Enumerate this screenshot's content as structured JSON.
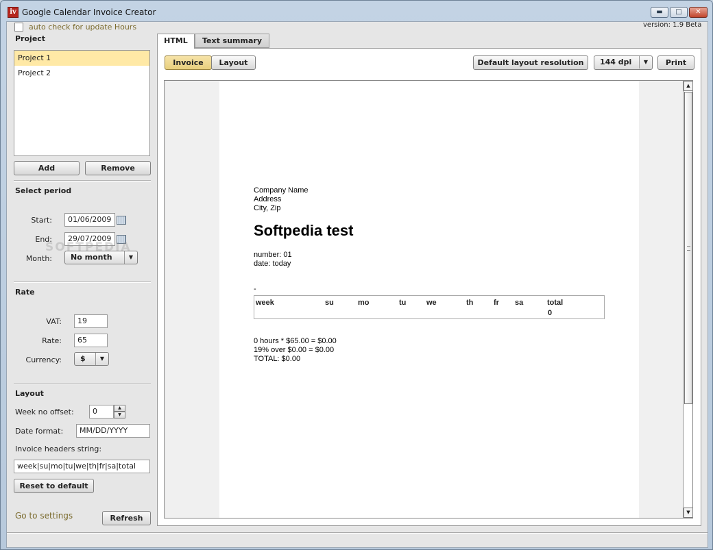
{
  "window": {
    "title": "Google Calendar Invoice Creator",
    "version": "version: 1.9 Beta"
  },
  "update": {
    "label": "auto check for update Hours"
  },
  "project": {
    "title": "Project",
    "items": [
      "Project 1",
      "Project 2"
    ],
    "add_label": "Add",
    "remove_label": "Remove"
  },
  "period": {
    "title": "Select period",
    "start_label": "Start:",
    "start_value": "01/06/2009",
    "end_label": "End:",
    "end_value": "29/07/2009",
    "month_label": "Month:",
    "month_value": "No month"
  },
  "watermark": "SOFTPEDIA",
  "rate": {
    "title": "Rate",
    "vat_label": "VAT:",
    "vat_value": "19",
    "rate_label": "Rate:",
    "rate_value": "65",
    "currency_label": "Currency:",
    "currency_value": "$"
  },
  "layout": {
    "title": "Layout",
    "week_offset_label": "Week no offset:",
    "week_offset_value": "0",
    "date_format_label": "Date format:",
    "date_format_value": "MM/DD/YYYY",
    "headers_label": "Invoice headers string:",
    "headers_value": "week|su|mo|tu|we|th|fr|sa|total",
    "reset_label": "Reset to default"
  },
  "footer": {
    "settings_link": "Go to settings",
    "refresh_label": "Refresh"
  },
  "tabs": {
    "html": "HTML",
    "text_summary": "Text summary"
  },
  "toolbar": {
    "invoice_label": "Invoice",
    "layout_label": "Layout",
    "default_layout_label": "Default layout resolution",
    "dpi_value": "144 dpi",
    "print_label": "Print"
  },
  "invoice": {
    "company": "Company Name",
    "address": "Address",
    "city": "City, Zip",
    "title": "Softpedia test",
    "number": "number: 01",
    "date": "date: today",
    "dash": "-",
    "headers": [
      "week",
      "su",
      "mo",
      "tu",
      "we",
      "th",
      "fr",
      "sa",
      "total"
    ],
    "total_value": "0",
    "calc_hours": "0 hours * $65.00 = $0.00",
    "calc_vat": "19% over $0.00 = $0.00",
    "calc_total": "TOTAL: $0.00"
  },
  "colors": {
    "accent": "#ffe9a6",
    "link": "#7a6a2c",
    "titlebar": "#c3d3e4"
  },
  "icons": [
    "app-icon",
    "minimize-icon",
    "maximize-icon",
    "close-icon",
    "calendar-icon",
    "chevron-down-icon",
    "spin-up-icon",
    "spin-down-icon",
    "scroll-up-icon",
    "scroll-down-icon"
  ]
}
